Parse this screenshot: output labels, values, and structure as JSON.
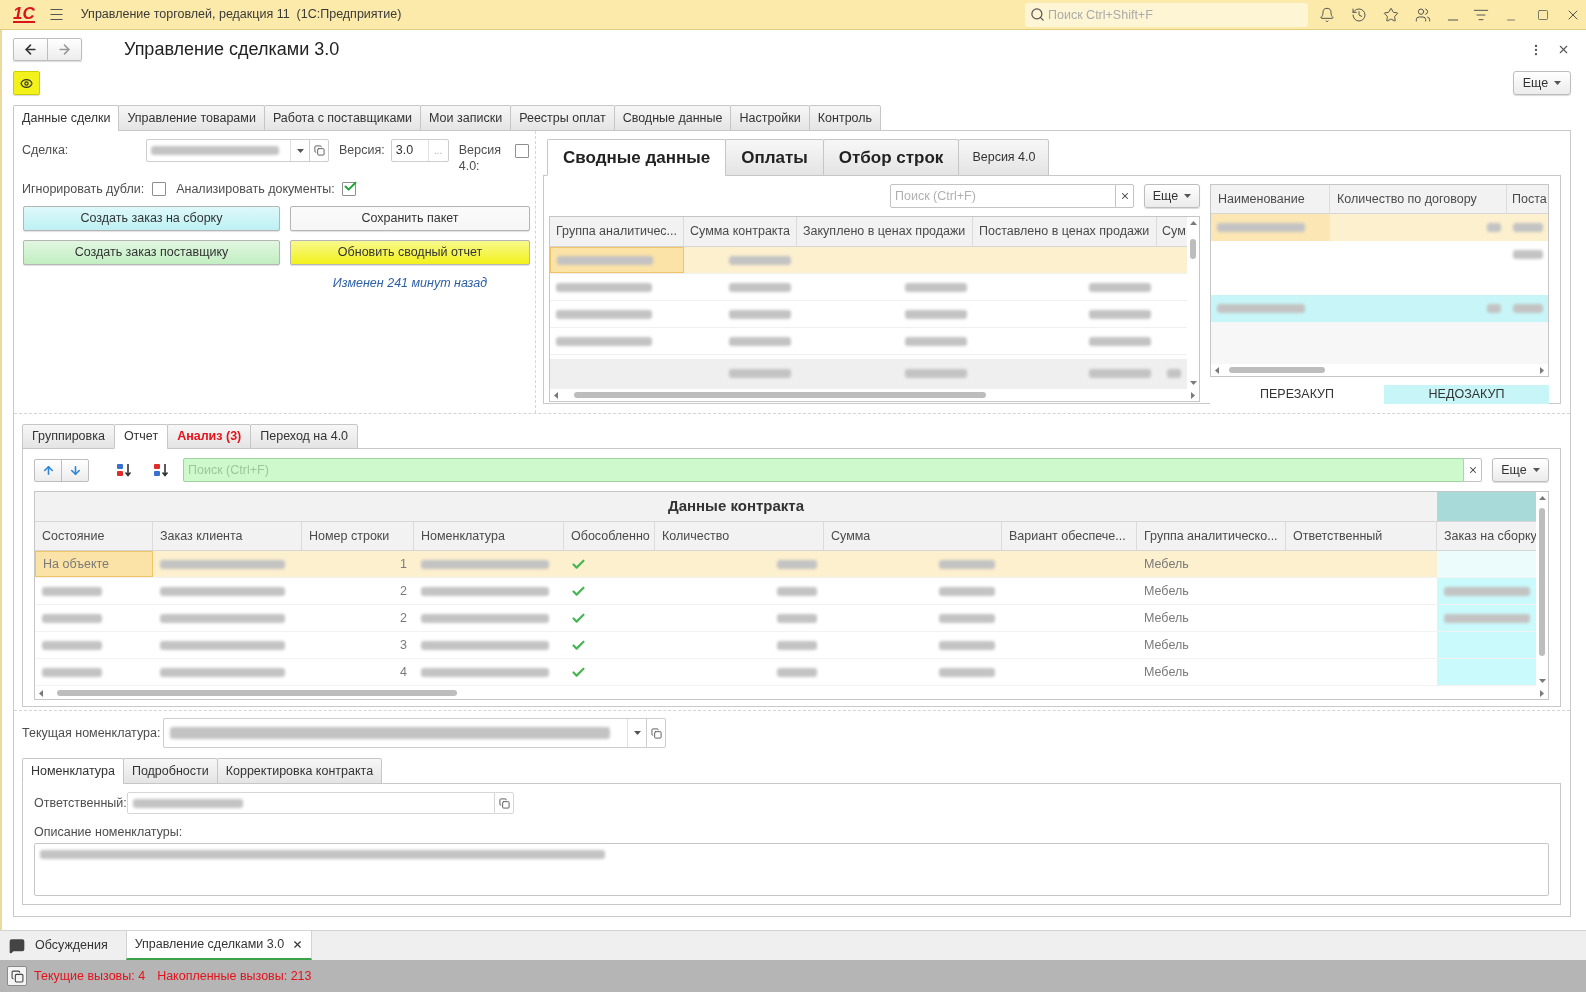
{
  "app_bar": {
    "logo": "1С",
    "title": "Управление торговлей, редакция 11  (1С:Предприятие)",
    "search": {
      "placeholder": "Поиск Ctrl+Shift+F"
    }
  },
  "form": {
    "title": "Управление сделками 3.0",
    "more_button": "Еще"
  },
  "tabs": [
    {
      "label": "Данные сделки",
      "selected": true
    },
    {
      "label": "Управление товарами",
      "selected": false
    },
    {
      "label": "Работа с поставщиками",
      "selected": false
    },
    {
      "label": "Мои записки",
      "selected": false
    },
    {
      "label": "Реестры оплат",
      "selected": false
    },
    {
      "label": "Сводные данные",
      "selected": false
    },
    {
      "label": "Настройки",
      "selected": false
    },
    {
      "label": "Контроль",
      "selected": false
    }
  ],
  "deal": {
    "deal_field": {
      "label": "Сделка:",
      "blurred": true
    },
    "version_field": {
      "label": "Версия:",
      "value": "3.0",
      "choose_button": "..."
    },
    "version4": {
      "label": "Версия 4.0:",
      "checked": false
    },
    "ignore_duplicates": {
      "label": "Игнорировать дубли:",
      "checked": false
    },
    "analyze_documents": {
      "label": "Анализировать документы:",
      "checked": true
    },
    "buttons": [
      {
        "label": "Создать заказ на сборку",
        "color": "#bdf1f4"
      },
      {
        "label": "Сохранить пакет",
        "color": "#f6f6f6"
      },
      {
        "label": "Создать заказ поставщику",
        "color": "#c2eec2"
      },
      {
        "label": "Обновить сводный отчет",
        "color": "#f2f21c"
      }
    ],
    "modified_note": "Изменен 241 минут назад"
  },
  "summary": {
    "tabs": [
      {
        "label": "Сводные данные",
        "selected": true,
        "kind": "large"
      },
      {
        "label": "Оплаты",
        "selected": false,
        "kind": "large"
      },
      {
        "label": "Отбор строк",
        "selected": false,
        "kind": "large"
      },
      {
        "label": "Версия 4.0",
        "selected": false,
        "kind": "small"
      }
    ],
    "search": {
      "placeholder": "Поиск (Ctrl+F)"
    },
    "more_button": "Еще",
    "table": {
      "columns": [
        "Группа аналитичес...",
        "Сумма контракта",
        "Закуплено в ценах продажи",
        "Поставлено в ценах продажи",
        "Сум"
      ],
      "rows": [
        {
          "kind": "data",
          "selected": true,
          "blurred": [
            true,
            true,
            false,
            false,
            false
          ]
        },
        {
          "kind": "data",
          "selected": false,
          "blurred": [
            true,
            true,
            true,
            true,
            false
          ]
        },
        {
          "kind": "data",
          "selected": false,
          "blurred": [
            true,
            true,
            true,
            true,
            false
          ]
        },
        {
          "kind": "data",
          "selected": false,
          "blurred": [
            true,
            true,
            true,
            true,
            false
          ]
        },
        {
          "kind": "total",
          "selected": false,
          "blurred": [
            false,
            true,
            true,
            true,
            true
          ]
        }
      ]
    },
    "plan_table": {
      "columns": [
        "Наименование",
        "Количество по договору",
        "Поста"
      ],
      "rows": [
        {
          "selected": true,
          "blurred": [
            true,
            true,
            true
          ]
        },
        {
          "selected": false,
          "color": "#ffffff",
          "blurred": [
            false,
            false,
            true
          ]
        },
        {
          "selected": false,
          "color": "#ffffff",
          "blurred": [
            false,
            false,
            false
          ]
        },
        {
          "selected": false,
          "color": "#c8f6f8",
          "blurred": [
            true,
            true,
            true
          ]
        }
      ]
    },
    "legend": [
      {
        "label": "ПЕРЕЗАКУП",
        "color": "#ffffff"
      },
      {
        "label": "НЕДОЗАКУП",
        "color": "#c8f6f8"
      }
    ]
  },
  "report": {
    "tabs": [
      {
        "label": "Группировка",
        "selected": false,
        "alert": false
      },
      {
        "label": "Отчет",
        "selected": true,
        "alert": false
      },
      {
        "label": "Анализ (3)",
        "selected": false,
        "alert": true
      },
      {
        "label": "Переход на 4.0",
        "selected": false,
        "alert": false
      }
    ],
    "search": {
      "placeholder": "Поиск (Ctrl+F)"
    },
    "more_button": "Еще",
    "table": {
      "column_groups": [
        {
          "title": "Данные контракта",
          "columns": [
            "Состояние",
            "Заказ клиента",
            "Номер строки",
            "Номенклатура",
            "Обособленно",
            "Количество",
            "Сумма",
            "Вариант обеспече...",
            "Группа аналитическо...",
            "Ответственный"
          ]
        },
        {
          "color": "#a9dada",
          "columns": [
            "Заказ на сборку"
          ]
        }
      ],
      "rows": [
        {
          "selected": true,
          "cells": [
            {
              "kind": "text",
              "text": "На объекте"
            },
            {
              "kind": "blurred"
            },
            {
              "kind": "text",
              "text": "1"
            },
            {
              "kind": "blurred"
            },
            {
              "kind": "check",
              "checked": true
            },
            {
              "kind": "blurred"
            },
            {
              "kind": "blurred"
            },
            {
              "kind": "empty"
            },
            {
              "kind": "text",
              "text": "Мебель"
            },
            {
              "kind": "empty"
            },
            {
              "kind": "empty",
              "color": "#ecfcfd"
            }
          ]
        },
        {
          "selected": false,
          "cells": [
            {
              "kind": "blurred"
            },
            {
              "kind": "blurred"
            },
            {
              "kind": "text",
              "text": "2"
            },
            {
              "kind": "blurred"
            },
            {
              "kind": "check",
              "checked": true
            },
            {
              "kind": "blurred"
            },
            {
              "kind": "blurred"
            },
            {
              "kind": "empty"
            },
            {
              "kind": "text",
              "text": "Мебель"
            },
            {
              "kind": "empty"
            },
            {
              "kind": "blurred",
              "color": "#cbfafc"
            }
          ]
        },
        {
          "selected": false,
          "cells": [
            {
              "kind": "blurred"
            },
            {
              "kind": "blurred"
            },
            {
              "kind": "text",
              "text": "2"
            },
            {
              "kind": "blurred"
            },
            {
              "kind": "check",
              "checked": true
            },
            {
              "kind": "blurred"
            },
            {
              "kind": "blurred"
            },
            {
              "kind": "empty"
            },
            {
              "kind": "text",
              "text": "Мебель"
            },
            {
              "kind": "empty"
            },
            {
              "kind": "blurred",
              "color": "#cbfafc"
            }
          ]
        },
        {
          "selected": false,
          "cells": [
            {
              "kind": "blurred"
            },
            {
              "kind": "blurred"
            },
            {
              "kind": "text",
              "text": "3"
            },
            {
              "kind": "blurred"
            },
            {
              "kind": "check",
              "checked": true
            },
            {
              "kind": "blurred"
            },
            {
              "kind": "blurred"
            },
            {
              "kind": "empty"
            },
            {
              "kind": "text",
              "text": "Мебель"
            },
            {
              "kind": "empty"
            },
            {
              "kind": "empty",
              "color": "#cbfafc"
            }
          ]
        },
        {
          "selected": false,
          "cells": [
            {
              "kind": "blurred"
            },
            {
              "kind": "blurred"
            },
            {
              "kind": "text",
              "text": "4"
            },
            {
              "kind": "blurred"
            },
            {
              "kind": "check",
              "checked": true
            },
            {
              "kind": "blurred"
            },
            {
              "kind": "blurred"
            },
            {
              "kind": "empty"
            },
            {
              "kind": "text",
              "text": "Мебель"
            },
            {
              "kind": "empty"
            },
            {
              "kind": "empty",
              "color": "#cbfafc"
            }
          ]
        }
      ]
    }
  },
  "current_item": {
    "label": "Текущая номенклатура:",
    "blurred": true
  },
  "details": {
    "tabs": [
      {
        "label": "Номенклатура",
        "selected": true
      },
      {
        "label": "Подробности",
        "selected": false
      },
      {
        "label": "Корректировка контракта",
        "selected": false
      }
    ],
    "responsible": {
      "label": "Ответственный:",
      "blurred": true
    },
    "description": {
      "label": "Описание номенклатуры:",
      "blurred": true
    }
  },
  "taskbar": [
    {
      "kind": "discussions",
      "label": "Обсуждения",
      "selected": false
    },
    {
      "kind": "window",
      "label": "Управление сделками 3.0",
      "selected": true
    }
  ],
  "status_bar": [
    "Текущие вызовы: 4",
    "Накопленные вызовы: 213"
  ]
}
